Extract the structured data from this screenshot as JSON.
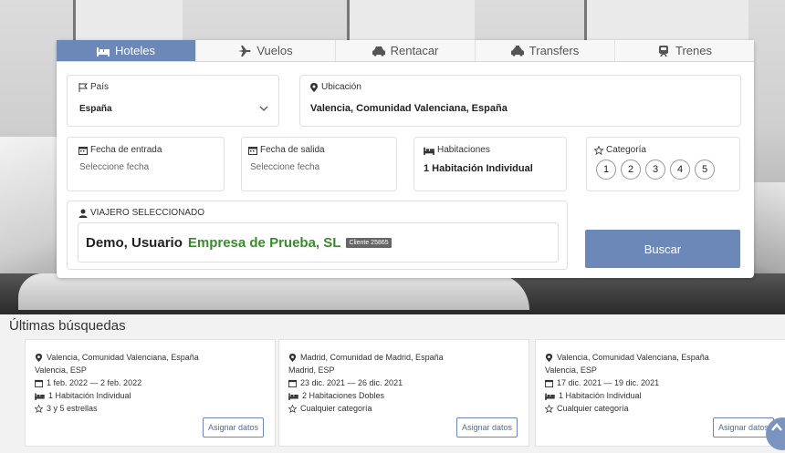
{
  "tabs": [
    {
      "label": "Hoteles",
      "icon": "bed-icon",
      "active": true
    },
    {
      "label": "Vuelos",
      "icon": "plane-icon"
    },
    {
      "label": "Rentacar",
      "icon": "car-icon"
    },
    {
      "label": "Transfers",
      "icon": "taxi-icon"
    },
    {
      "label": "Trenes",
      "icon": "train-icon"
    }
  ],
  "form": {
    "country_label": "País",
    "country_value": "España",
    "location_label": "Ubicación",
    "location_value": "Valencia, Comunidad Valenciana, España",
    "checkin_label": "Fecha de entrada",
    "checkin_placeholder": "Seleccione fecha",
    "checkout_label": "Fecha de salida",
    "checkout_placeholder": "Seleccione fecha",
    "rooms_label": "Habitaciones",
    "rooms_value": "1 Habitación Individual",
    "category_label": "Categoría",
    "category_options": [
      "1",
      "2",
      "3",
      "4",
      "5"
    ],
    "traveler_label": "VIAJERO SELECCIONADO",
    "traveler_name": "Demo, Usuario",
    "traveler_company": "Empresa de Prueba, SL",
    "traveler_badge": "Cliente 25865",
    "search_button": "Buscar"
  },
  "recent": {
    "title": "Últimas búsquedas",
    "assign_label": "Asignar datos",
    "items": [
      {
        "location": "Valencia, Comunidad Valenciana, España",
        "city": "Valencia, ESP",
        "dates": "1 feb. 2022 — 2 feb. 2022",
        "rooms": "1 Habitación Individual",
        "category": "3 y 5 estrellas"
      },
      {
        "location": "Madrid, Comunidad de Madrid, España",
        "city": "Madrid, ESP",
        "dates": "23 dic. 2021 — 26 dic. 2021",
        "rooms": "2 Habitaciones Dobles",
        "category": "Cualquier categoría"
      },
      {
        "location": "Valencia, Comunidad Valenciana, España",
        "city": "Valencia, ESP",
        "dates": "17 dic. 2021 — 19 dic. 2021",
        "rooms": "1 Habitación Individual",
        "category": "Cualquier categoría"
      }
    ]
  },
  "colors": {
    "accent": "#6c88b8",
    "company": "#3a8a2e"
  }
}
